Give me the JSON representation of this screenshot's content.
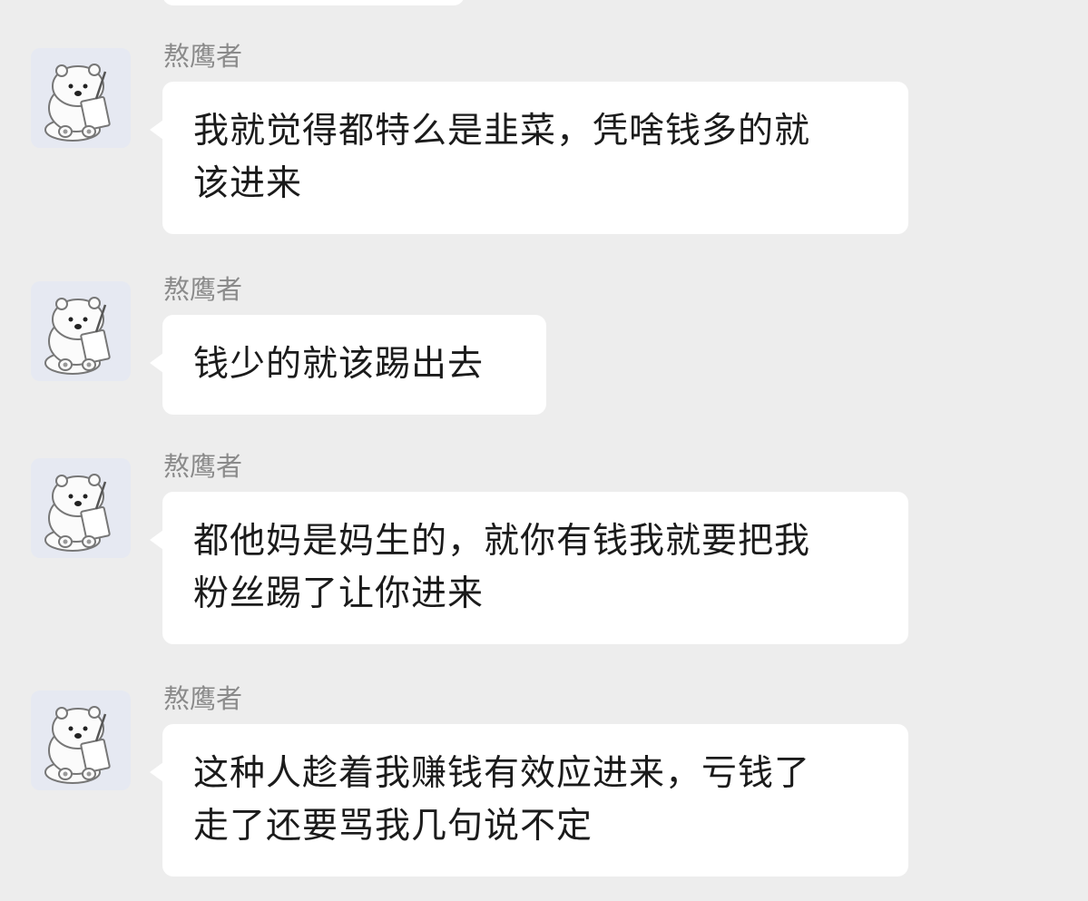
{
  "chat": {
    "messages": [
      {
        "sender": "熬鹰者",
        "avatar": "polar-bear-writing-avatar",
        "lines": [
          "我就觉得都特么是韭菜，凭啥钱多的就",
          "该进来"
        ]
      },
      {
        "sender": "熬鹰者",
        "avatar": "polar-bear-writing-avatar",
        "lines": [
          "钱少的就该踢出去"
        ]
      },
      {
        "sender": "熬鹰者",
        "avatar": "polar-bear-writing-avatar",
        "lines": [
          "都他妈是妈生的，就你有钱我就要把我",
          "粉丝踢了让你进来"
        ]
      },
      {
        "sender": "熬鹰者",
        "avatar": "polar-bear-writing-avatar",
        "lines": [
          "这种人趁着我赚钱有效应进来，亏钱了",
          "走了还要骂我几句说不定"
        ]
      }
    ]
  },
  "colors": {
    "background": "#ededed",
    "bubble": "#ffffff",
    "sender_text": "#8a8a8a",
    "message_text": "#1b1b1b",
    "avatar_background": "#e6e9f2"
  }
}
